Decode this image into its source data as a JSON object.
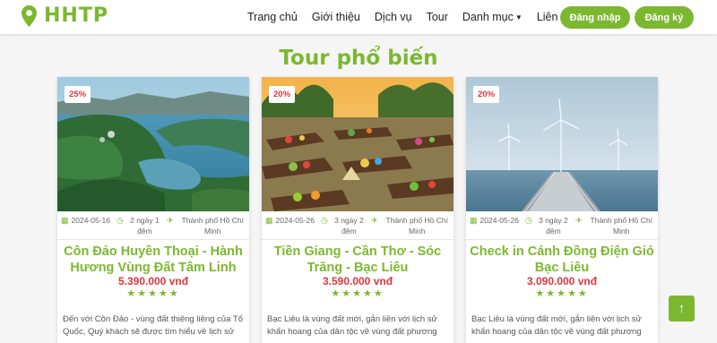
{
  "brand": {
    "name": "HHTP",
    "icon": "map-pin-icon",
    "color": "#7cb82f"
  },
  "nav": {
    "items": [
      "Trang chủ",
      "Giới thiệu",
      "Dịch vụ",
      "Tour",
      "Danh mục",
      "Liên hệ"
    ],
    "login": "Đăng nhập",
    "register": "Đăng ký"
  },
  "section": {
    "title": "Tour phổ biến"
  },
  "tours": [
    {
      "discount": "25%",
      "date": "2024-05-16",
      "duration": "2 ngày 1 đêm",
      "departure": "Thành phố Hồ Chí Minh",
      "title": "Côn Đảo Huyền Thoại - Hành Hương Vùng Đất Tâm Linh",
      "price": "5.390.000 vnđ",
      "rating": 5,
      "description": "Đến với Côn Đảo - vùng đất thiêng liêng của Tổ Quốc, Quý khách sẽ được tìm hiểu về lịch sử"
    },
    {
      "discount": "20%",
      "date": "2024-05-26",
      "duration": "3 ngày 2 đêm",
      "departure": "Thành phố Hồ Chí Minh",
      "title": "Tiền Giang - Cần Thơ - Sóc Trăng - Bạc Liêu",
      "price": "3.590.000 vnđ",
      "rating": 5,
      "description": "Bạc Liêu là vùng đất mới, gắn liền với lịch sử khẩn hoang của dân tộc về vùng đất phương"
    },
    {
      "discount": "20%",
      "date": "2024-05-26",
      "duration": "3 ngày 2 đêm",
      "departure": "Thành phố Hồ Chí Minh",
      "title": "Check in Cánh Đồng Điện Gió Bạc Liêu",
      "price": "3.090.000 vnđ",
      "rating": 5,
      "description": "Bạc Liêu là vùng đất mới, gắn liền với lịch sử khẩn hoang của dân tộc về vùng đất phương"
    }
  ],
  "icons": {
    "date": "calendar-icon",
    "duration": "clock-icon",
    "departure": "plane-icon",
    "back_to_top": "arrow-up-icon"
  }
}
